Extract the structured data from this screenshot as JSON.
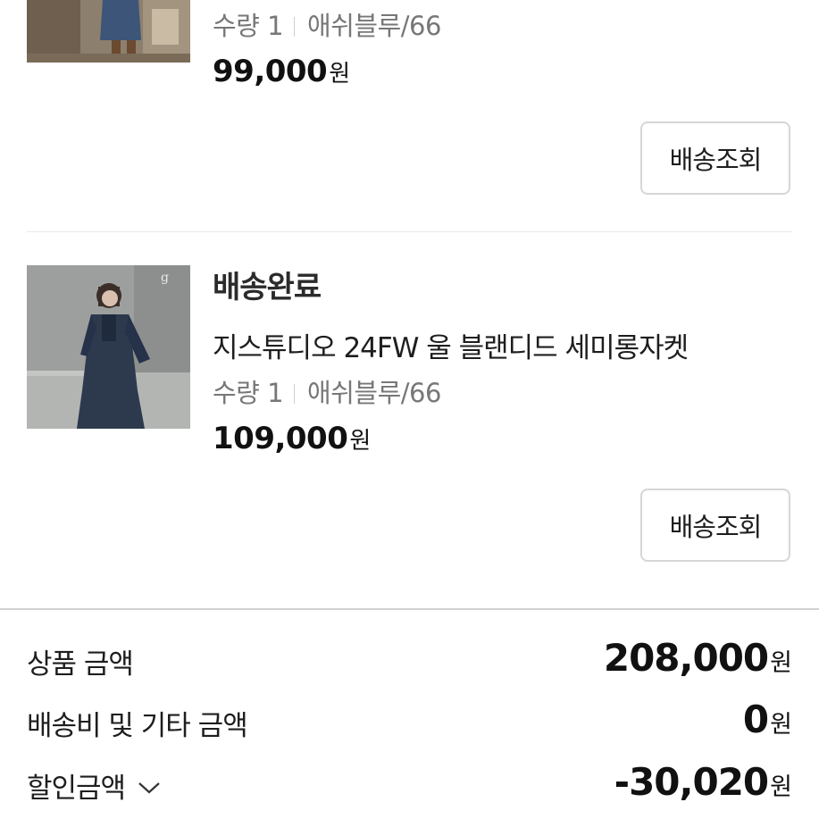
{
  "orders": [
    {
      "status": "",
      "product_name": "",
      "quantity": "수량 1",
      "option": "애쉬블루/66",
      "price": "99,000",
      "currency": "원",
      "track_button": "배송조회"
    },
    {
      "status": "배송완료",
      "product_name": "지스튜디오 24FW 울 블랜디드 세미롱자켓",
      "quantity": "수량 1",
      "option": "애쉬블루/66",
      "price": "109,000",
      "currency": "원",
      "track_button": "배송조회"
    }
  ],
  "summary": {
    "product_amount_label": "상품 금액",
    "product_amount": "208,000",
    "shipping_label": "배송비 및 기타 금액",
    "shipping_amount": "0",
    "discount_label": "할인금액",
    "discount_amount": "-30,020",
    "currency": "원",
    "discount_toggle_icon": "chevron-down-icon"
  },
  "colors": {
    "button_border": "#d6d6d6",
    "muted_text": "#777777",
    "divider": "#d2d2d2"
  }
}
